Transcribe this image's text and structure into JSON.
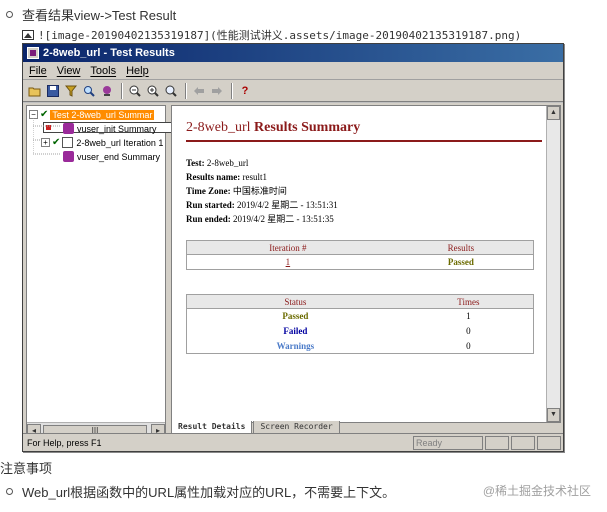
{
  "doc": {
    "line1": "查看结果view->Test Result",
    "line2": "![image-20190402135319187](性能测试讲义.assets/image-20190402135319187.png)",
    "line3": "注意事项",
    "line4": "Web_url根据函数中的URL属性加载对应的URL，不需要上下文。",
    "watermark": "@稀土掘金技术社区"
  },
  "window": {
    "title": "2-8web_url - Test Results",
    "menu": [
      "File",
      "View",
      "Tools",
      "Help"
    ],
    "toolbar_icons": [
      "open-icon",
      "save-icon",
      "filter-icon",
      "search-icon",
      "find-icon",
      "zoom-out-icon",
      "zoom-in-icon",
      "zoom-fit-icon",
      "back-icon",
      "forward-icon",
      "help-icon"
    ]
  },
  "tree": {
    "root": "Test 2-8web_url Summar",
    "children": [
      "vuser_init Summary",
      "2-8web_url Iteration 1",
      "vuser_end Summary"
    ],
    "scroll_label": "III"
  },
  "report": {
    "title_name": "2-8web_url",
    "title_rest": "Results Summary",
    "test_label": "Test:",
    "test_value": "2-8web_url",
    "results_label": "Results name:",
    "results_value": "result1",
    "tz_label": "Time Zone:",
    "tz_value": "中国标准时间",
    "start_label": "Run started:",
    "start_value": "2019/4/2 星期二 - 13:51:31",
    "end_label": "Run ended:",
    "end_value": "2019/4/2 星期二 - 13:51:35",
    "iter_table": {
      "headers": [
        "Iteration #",
        "Results"
      ],
      "rows": [
        {
          "iteration": "1",
          "result": "Passed"
        }
      ]
    },
    "status_table": {
      "headers": [
        "Status",
        "Times"
      ],
      "rows": [
        {
          "status": "Passed",
          "times": "1"
        },
        {
          "status": "Failed",
          "times": "0"
        },
        {
          "status": "Warnings",
          "times": "0"
        }
      ]
    }
  },
  "tabs": [
    "Result Details",
    "Screen Recorder"
  ],
  "statusbar": {
    "help": "For Help, press F1",
    "ready": "Ready"
  }
}
